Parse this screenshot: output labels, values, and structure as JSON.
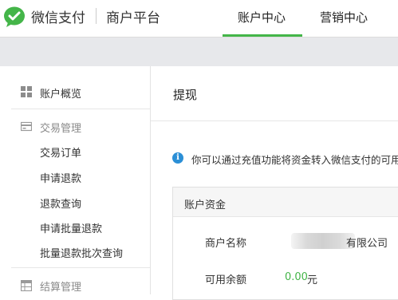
{
  "header": {
    "brand": "微信支付",
    "platform": "商户平台",
    "nav": [
      {
        "label": "账户中心",
        "active": true
      },
      {
        "label": "营销中心",
        "active": false
      }
    ],
    "accent_color": "#44b549"
  },
  "sidebar": {
    "overview": {
      "label": "账户概览",
      "icon": "grid-icon"
    },
    "trade_section": {
      "label": "交易管理",
      "icon": "card-icon"
    },
    "trade_items": [
      {
        "label": "交易订单"
      },
      {
        "label": "申请退款"
      },
      {
        "label": "退款查询"
      },
      {
        "label": "申请批量退款"
      },
      {
        "label": "批量退款批次查询"
      }
    ],
    "settlement_section": {
      "label": "结算管理",
      "icon": "table-icon"
    }
  },
  "main": {
    "title": "提现",
    "notice": "你可以通过充值功能将资金转入微信支付的可用",
    "funds": {
      "title": "账户资金",
      "merchant_label": "商户名称",
      "merchant_value": "有限公司",
      "balance_label": "可用余额",
      "balance_amount": "0.00",
      "balance_unit": "元"
    }
  }
}
